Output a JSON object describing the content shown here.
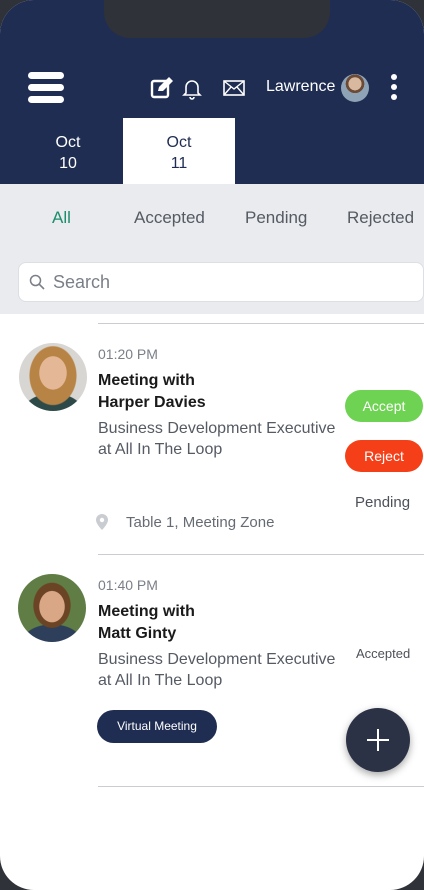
{
  "header": {
    "user_name": "Lawrence",
    "icons": [
      "menu-icon",
      "compose-icon",
      "bell-icon",
      "mail-icon",
      "more-vertical-icon"
    ]
  },
  "dates": [
    {
      "month": "Oct",
      "day": "10",
      "selected": false
    },
    {
      "month": "Oct",
      "day": "11",
      "selected": true
    }
  ],
  "filters": {
    "all": "All",
    "accepted": "Accepted",
    "pending": "Pending",
    "rejected": "Rejected"
  },
  "search": {
    "placeholder": "Search"
  },
  "meetings": [
    {
      "time": "01:20 PM",
      "title_line1": "Meeting with",
      "title_line2": "Harper Davies",
      "role": "Business Development Executive",
      "company": "at  All In The Loop",
      "accept_label": "Accept",
      "reject_label": "Reject",
      "status": "Pending",
      "location": "Table 1, Meeting Zone"
    },
    {
      "time": "01:40 PM",
      "title_line1": "Meeting with",
      "title_line2": "Matt Ginty",
      "role": "Business Development Executive",
      "company": "at  All In The Loop",
      "status": "Accepted",
      "tag": "Virtual Meeting"
    }
  ],
  "colors": {
    "header_bg": "#1f2d52",
    "accent_green": "#1c8e6a",
    "accept": "#6ed352",
    "reject": "#f53f19",
    "fab": "#2c3245"
  }
}
